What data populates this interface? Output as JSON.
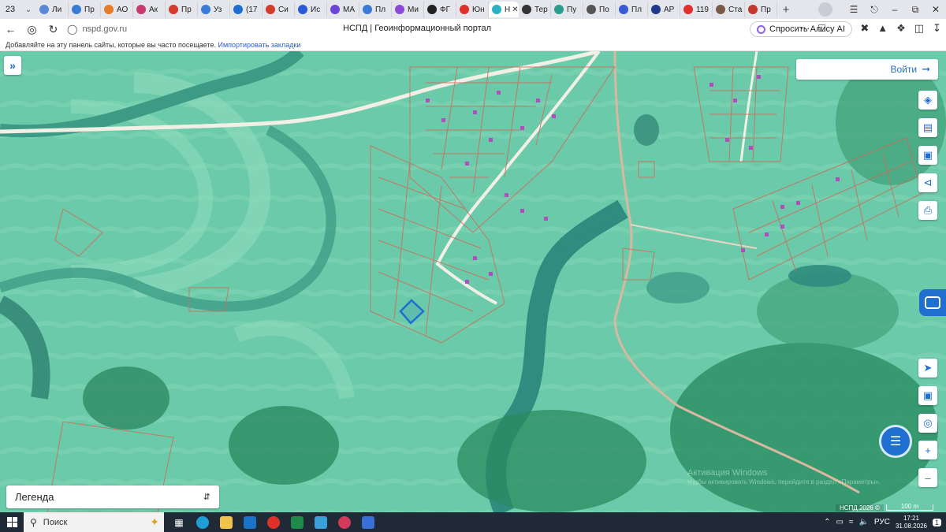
{
  "browser": {
    "tab_count": "23",
    "tabs": [
      {
        "label": "Ли",
        "icon": "vk-icon",
        "color": "#5b88d6"
      },
      {
        "label": "Пр",
        "icon": "globe-icon",
        "color": "#3a7bd5"
      },
      {
        "label": "АО",
        "icon": "flame-icon",
        "color": "#e57c2a"
      },
      {
        "label": "Ак",
        "icon": "feather-icon",
        "color": "#c73b6d"
      },
      {
        "label": "Пр",
        "icon": "shield-icon",
        "color": "#d33b2c"
      },
      {
        "label": "Уз",
        "icon": "globe-icon",
        "color": "#3a7bd5"
      },
      {
        "label": "(17",
        "icon": "mail-icon",
        "color": "#1e6fd0"
      },
      {
        "label": "Си",
        "icon": "dots-icon",
        "color": "#d33b2c"
      },
      {
        "label": "Ис",
        "icon": "eye-icon",
        "color": "#2a5bd7"
      },
      {
        "label": "МА",
        "icon": "max-icon",
        "color": "#6c45d6"
      },
      {
        "label": "Пл",
        "icon": "doc-icon",
        "color": "#3a7bd5"
      },
      {
        "label": "Ми",
        "icon": "circle-icon",
        "color": "#8a4ad6"
      },
      {
        "label": "ФГ",
        "icon": "shield-icon",
        "color": "#222222"
      },
      {
        "label": "Юн",
        "icon": "pin-icon",
        "color": "#e0302a"
      },
      {
        "label": "Н",
        "icon": "nspd-icon",
        "color": "#2bb0c8",
        "active": true
      },
      {
        "label": "Тер",
        "icon": "home-icon",
        "color": "#333333"
      },
      {
        "label": "Пу",
        "icon": "feather-icon",
        "color": "#2a9d8f"
      },
      {
        "label": "По",
        "icon": "doc-icon",
        "color": "#555555"
      },
      {
        "label": "Пл",
        "icon": "crest-icon",
        "color": "#3a5bd5"
      },
      {
        "label": "АР",
        "icon": "dot-icon",
        "color": "#1e3a8a"
      },
      {
        "label": "119",
        "icon": "ya-icon",
        "color": "#e0302a"
      },
      {
        "label": "Ста",
        "icon": "avatar-icon",
        "color": "#7a5a4a"
      },
      {
        "label": "Пр",
        "icon": "avatar-icon",
        "color": "#c0392b"
      }
    ],
    "url": "nspd.gov.ru",
    "page_title": "НСПД | Геоинформационный портал",
    "alice_label": "Спросить Алису AI",
    "bookmarks_hint": "Добавляйте на эту панель сайты, которые вы часто посещаете.",
    "bookmarks_import": "Импортировать закладки"
  },
  "map": {
    "login_label": "Войти",
    "legend_label": "Легенда",
    "watermark_title": "Активация Windows",
    "watermark_sub": "Чтобы активировать Windows, перейдите в раздел «Параметры».",
    "copyright": "НСПД 2026 ©",
    "scale": "100 m",
    "colors": {
      "accent": "#1e6fd0",
      "parcel": "#d06a5a",
      "selected_parcel": "#1e6fd0"
    }
  },
  "taskbar": {
    "search_placeholder": "Поиск",
    "language": "РУС",
    "time": "17:21",
    "date": "31.08.2026",
    "notification_count": "1"
  }
}
